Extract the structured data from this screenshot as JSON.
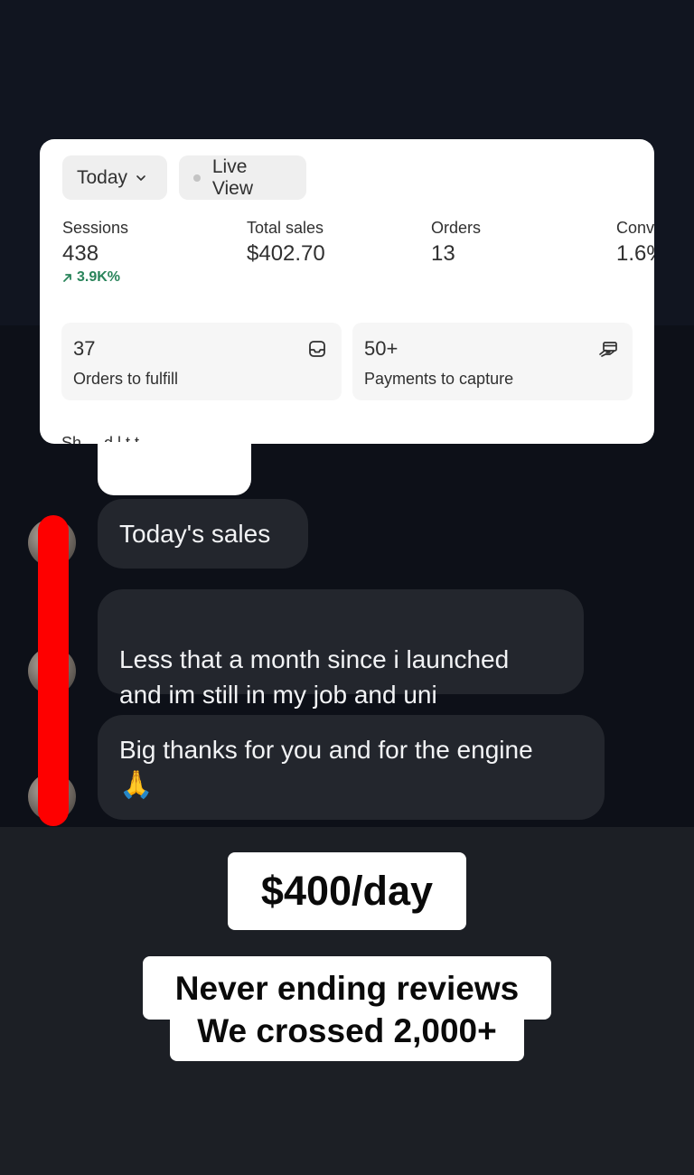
{
  "dashboard": {
    "date_filter": "Today",
    "live_view": "Live View",
    "metrics": [
      {
        "label": "Sessions",
        "value": "438",
        "delta": "3.9K%"
      },
      {
        "label": "Total sales",
        "value": "$402.70"
      },
      {
        "label": "Orders",
        "value": "13"
      },
      {
        "label": "Conv",
        "value": "1.6%"
      }
    ],
    "tasks": [
      {
        "count": "37",
        "label": "Orders to fulfill",
        "icon": "inbox-icon"
      },
      {
        "count": "50+",
        "label": "Payments to capture",
        "icon": "hand-payment-icon"
      }
    ],
    "cut_text": "Sh                    ...  d  l  t         t"
  },
  "chat": {
    "messages": [
      "Today's sales",
      "Less that a month since i launched\nand im still in my job and uni",
      "Big thanks for you and for the engine"
    ],
    "emoji": "🙏"
  },
  "captions": {
    "price": "$400/day",
    "line1": "Never ending reviews",
    "line2": "We crossed 2,000+"
  },
  "colors": {
    "redaction": "#fe0000",
    "bubble": "#23262d",
    "positive_delta": "#29845a"
  }
}
